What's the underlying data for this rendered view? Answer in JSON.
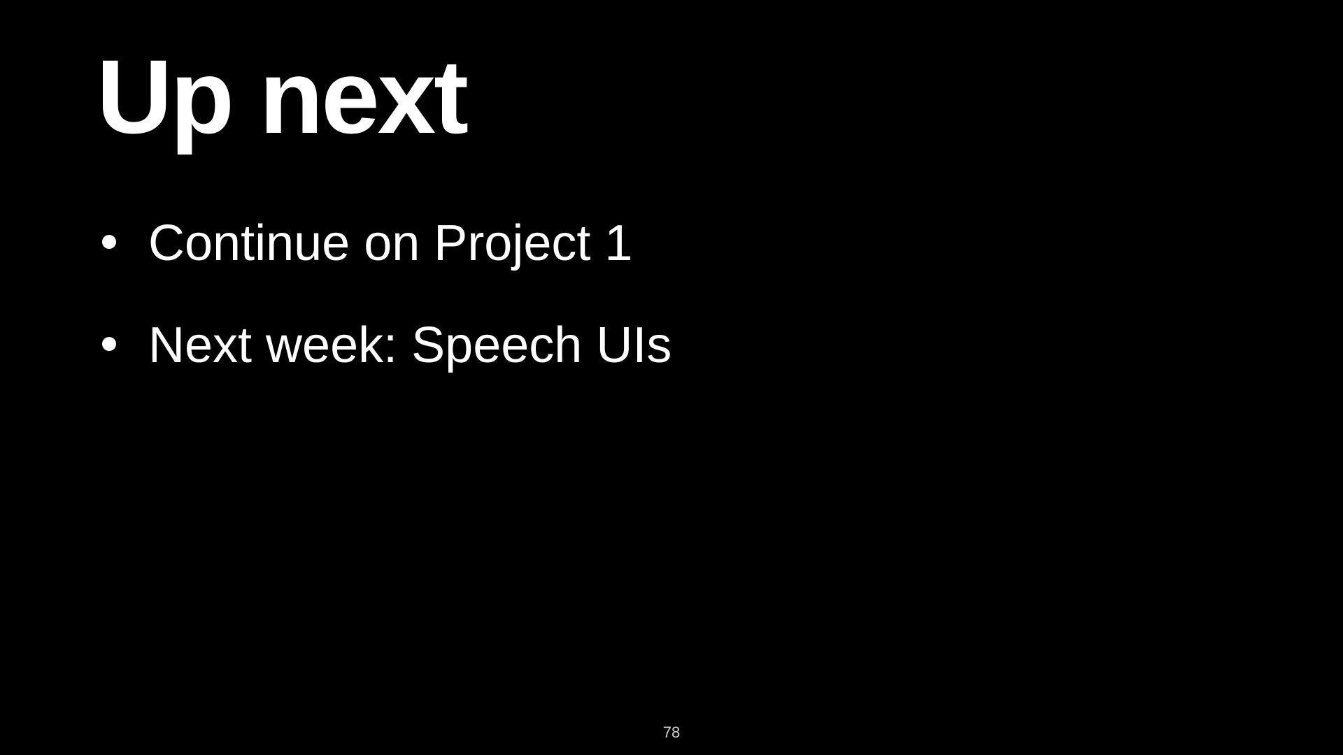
{
  "slide": {
    "title": "Up next",
    "bullets": [
      {
        "text": "Continue on Project 1"
      },
      {
        "text": "Next week: Speech UIs"
      }
    ],
    "page_number": "78"
  },
  "colors": {
    "background": "#000000",
    "text": "#ffffff"
  }
}
